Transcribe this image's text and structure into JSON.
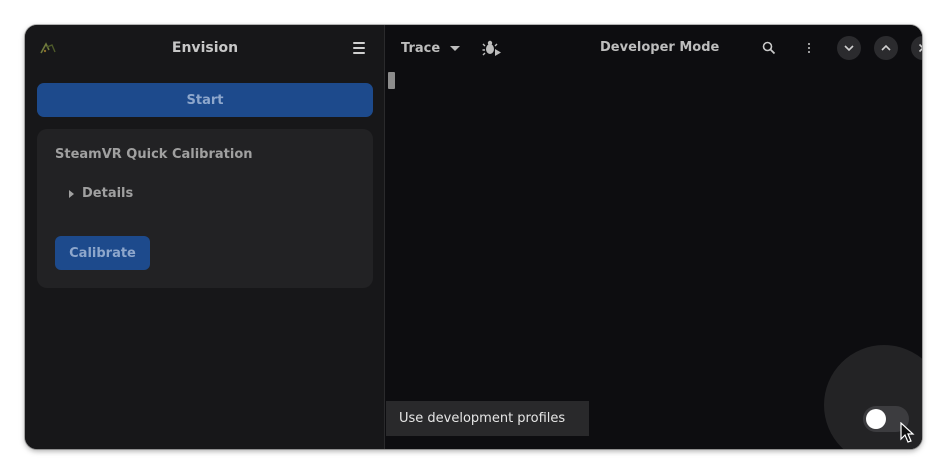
{
  "left_pane": {
    "app_title": "Envision",
    "start_label": "Start",
    "card": {
      "title": "SteamVR Quick Calibration",
      "details_label": "Details",
      "calibrate_label": "Calibrate"
    }
  },
  "right_pane": {
    "log_level": "Trace",
    "title": "Developer Mode",
    "tooltip": "Use development profiles",
    "toggle": {
      "checked": false
    }
  },
  "icons": {
    "app": "envision-logo-icon",
    "menu": "hamburger-menu-icon",
    "bug": "bug-play-icon",
    "search": "search-icon",
    "more": "more-vertical-icon",
    "minimize": "chevron-down-icon",
    "maximize": "chevron-up-icon",
    "close": "close-icon"
  },
  "colors": {
    "accent": "#1d4a8c",
    "background": "#0d0d10",
    "sidebar": "#171719"
  }
}
